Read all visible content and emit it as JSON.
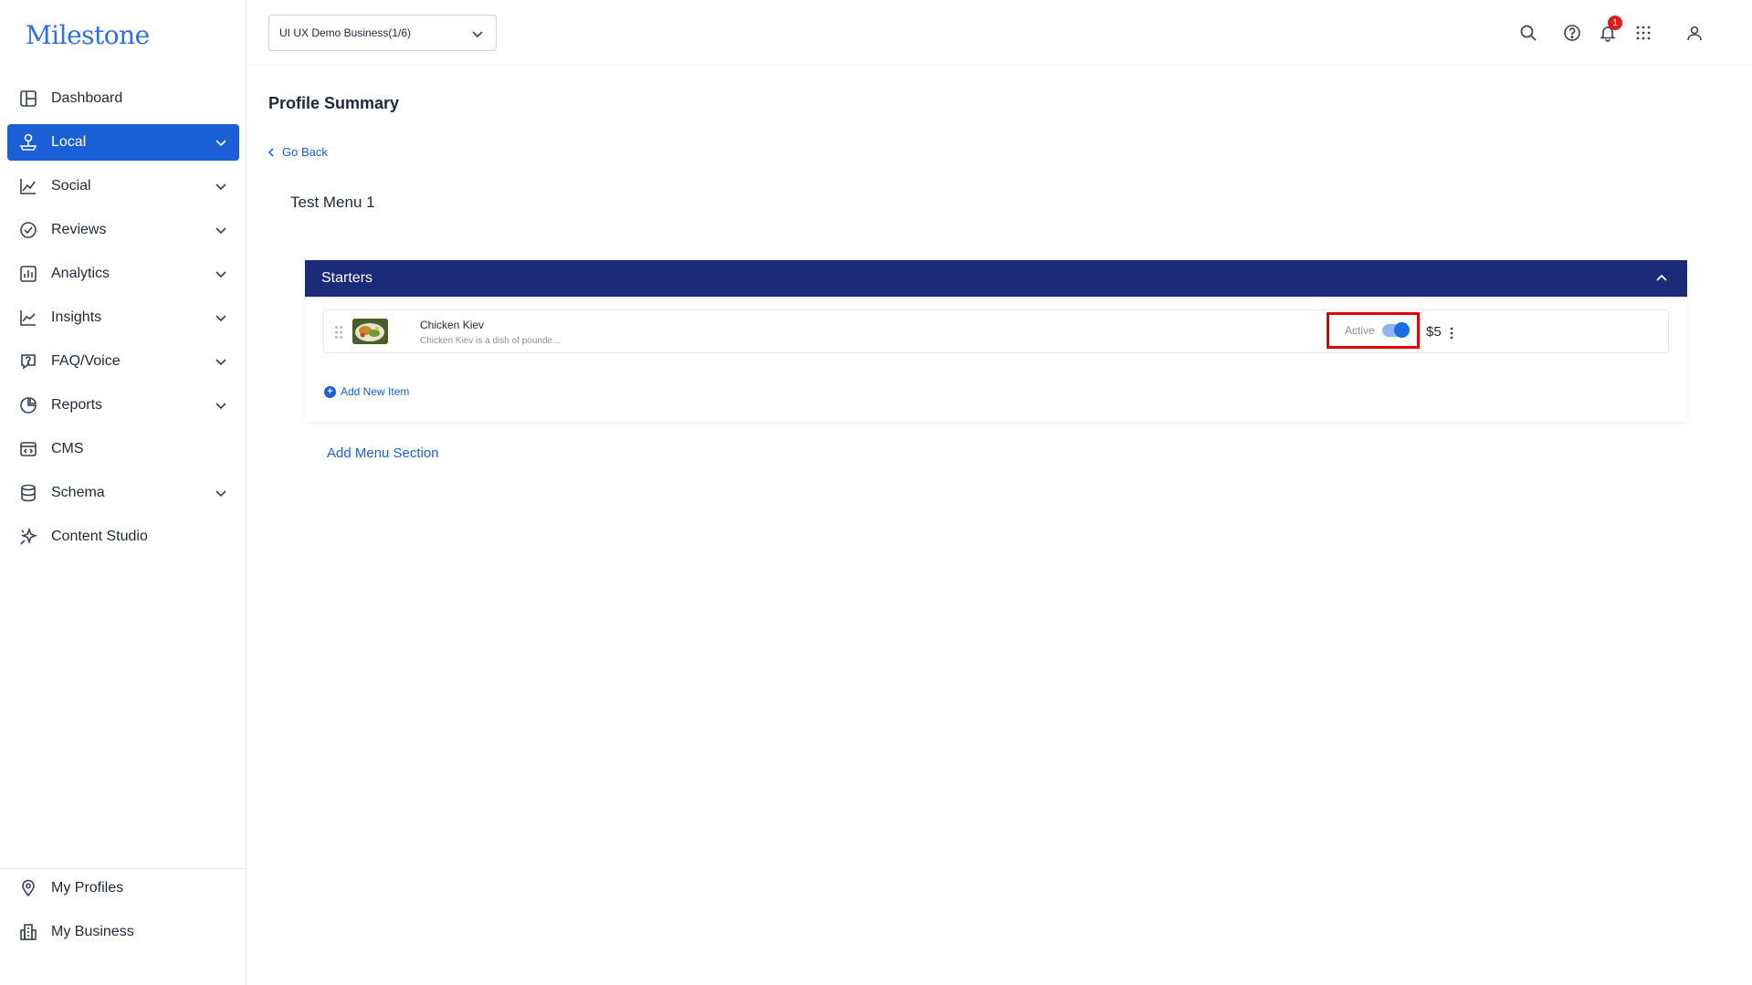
{
  "brand": {
    "logo_text": "Milestone",
    "accent": "#1a5fd6",
    "section_header_color": "#1c2a7a"
  },
  "sidebar": {
    "items": [
      {
        "label": "Dashboard",
        "icon": "dashboard-icon",
        "expandable": false,
        "active": false
      },
      {
        "label": "Local",
        "icon": "local-pin-icon",
        "expandable": true,
        "active": true
      },
      {
        "label": "Social",
        "icon": "social-chart-icon",
        "expandable": true,
        "active": false
      },
      {
        "label": "Reviews",
        "icon": "reviews-check-icon",
        "expandable": true,
        "active": false
      },
      {
        "label": "Analytics",
        "icon": "analytics-bar-icon",
        "expandable": true,
        "active": false
      },
      {
        "label": "Insights",
        "icon": "insights-line-icon",
        "expandable": true,
        "active": false
      },
      {
        "label": "FAQ/Voice",
        "icon": "faq-icon",
        "expandable": true,
        "active": false
      },
      {
        "label": "Reports",
        "icon": "reports-pie-icon",
        "expandable": true,
        "active": false
      },
      {
        "label": "CMS",
        "icon": "cms-icon",
        "expandable": false,
        "active": false
      },
      {
        "label": "Schema",
        "icon": "schema-database-icon",
        "expandable": true,
        "active": false
      },
      {
        "label": "Content Studio",
        "icon": "content-studio-sparkle-icon",
        "expandable": false,
        "active": false
      }
    ],
    "bottom_items": [
      {
        "label": "My Profiles",
        "icon": "location-pin-icon"
      },
      {
        "label": "My Business",
        "icon": "building-icon"
      }
    ]
  },
  "header": {
    "business_selector": "UI UX Demo Business(1/6)",
    "notification_count": "1",
    "icons": [
      "search-icon",
      "help-icon",
      "bell-icon",
      "apps-grid-icon",
      "user-icon"
    ]
  },
  "main": {
    "page_title": "Profile Summary",
    "go_back_label": "Go Back",
    "menu_name": "Test Menu 1",
    "sections": [
      {
        "title": "Starters",
        "items": [
          {
            "name": "Chicken Kiev",
            "description": "Chicken Kiev is a dish of pounde...",
            "status_label": "Active",
            "active": true,
            "price": "$5"
          }
        ],
        "add_item_label": "Add New Item"
      }
    ],
    "add_section_label": "Add Menu Section"
  }
}
